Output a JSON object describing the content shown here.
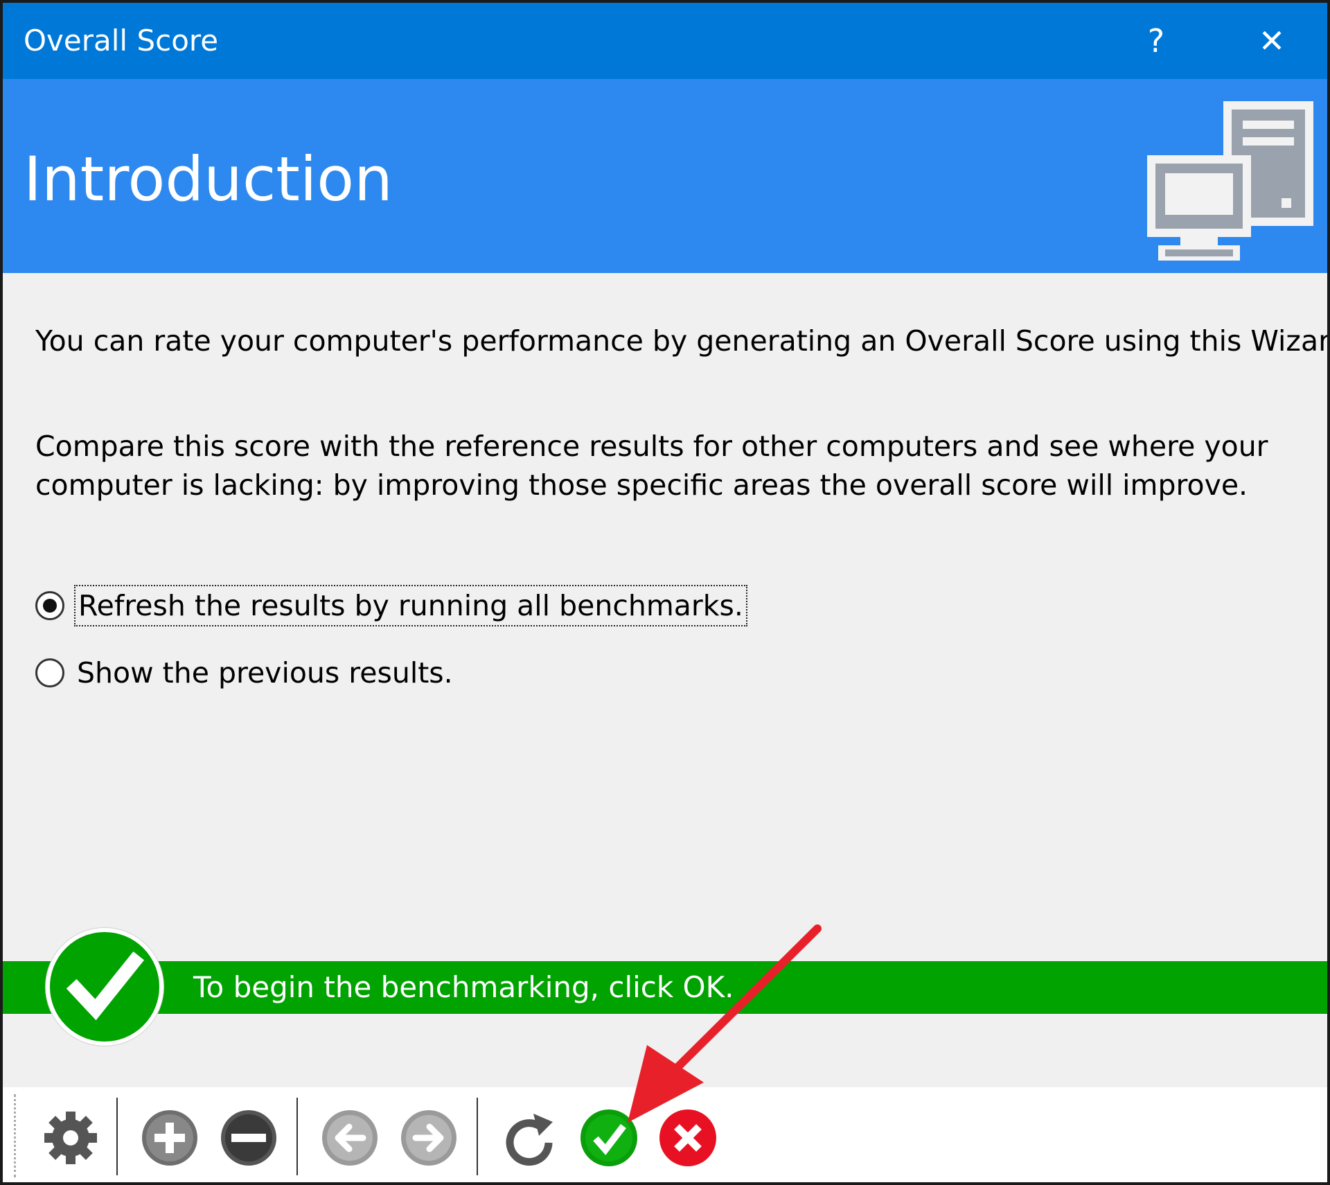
{
  "window": {
    "title": "Overall Score",
    "help_label": "?",
    "close_label": "✕"
  },
  "banner": {
    "heading": "Introduction",
    "icon": "computer-icon"
  },
  "content": {
    "paragraph1": "You can rate your computer's performance by generating an Overall Score using this Wizard.",
    "paragraph2": "Compare this score with the reference results for other computers and see where your computer is lacking: by improving those specific areas the overall score will improve.",
    "options": [
      {
        "label": "Refresh the results by running all benchmarks.",
        "selected": true
      },
      {
        "label": "Show the previous results.",
        "selected": false
      }
    ]
  },
  "status": {
    "message": "To begin the benchmarking, click OK.",
    "icon": "check-circle-icon",
    "color": "#00a300"
  },
  "toolbar": {
    "icons": [
      "gear-icon",
      "plus-circle-icon",
      "minus-circle-icon",
      "back-arrow-icon",
      "forward-arrow-icon",
      "refresh-icon",
      "ok-check-icon",
      "cancel-x-icon"
    ]
  },
  "colors": {
    "titlebar": "#0078d7",
    "banner": "#2d89ef",
    "status_green": "#00a300",
    "ok_green": "#0a9e0a",
    "cancel_red": "#e81123",
    "annotation_arrow": "#e8202a"
  }
}
